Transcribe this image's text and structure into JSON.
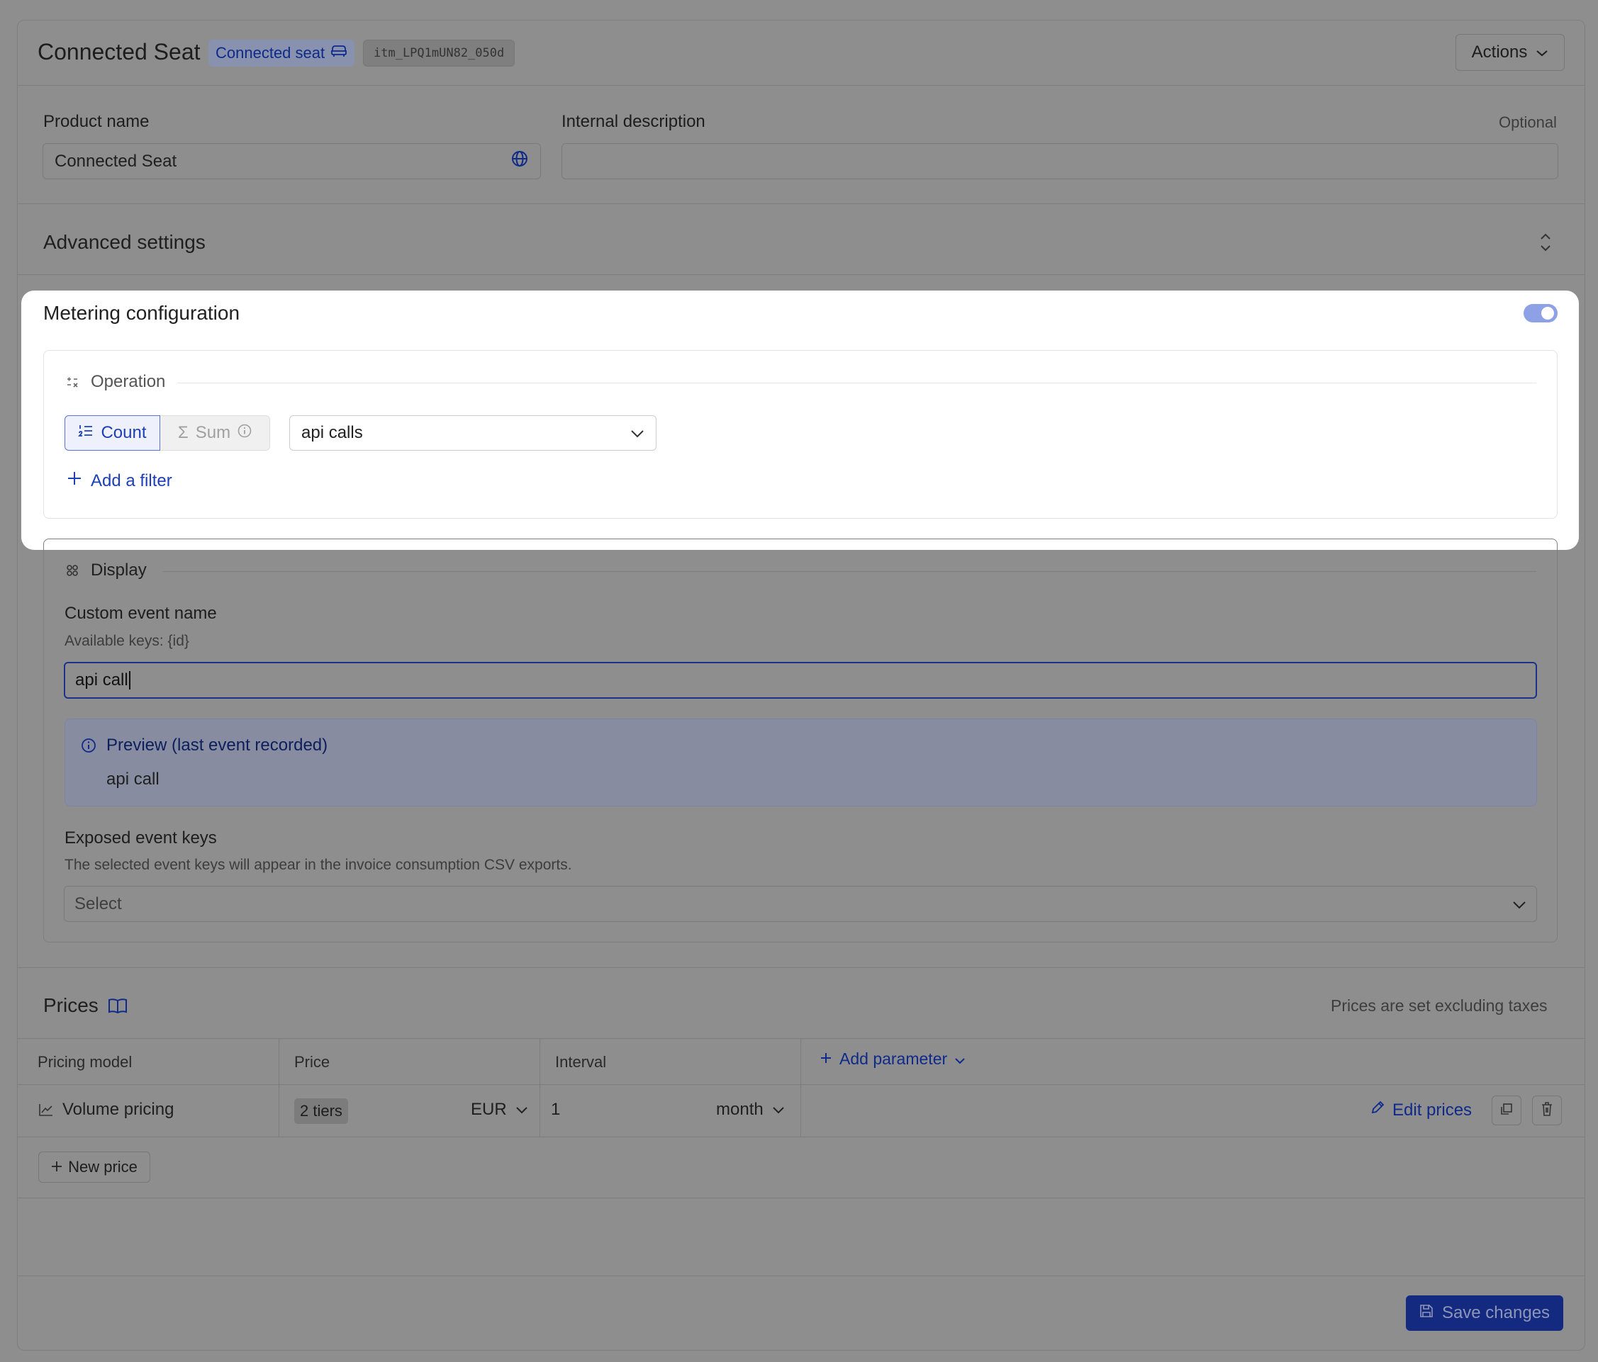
{
  "header": {
    "title": "Connected Seat",
    "type_badge": "Connected seat",
    "item_id": "itm_LPQ1mUN82_050d",
    "actions_label": "Actions"
  },
  "fields": {
    "product_name_label": "Product name",
    "product_name_value": "Connected Seat",
    "internal_description_label": "Internal description",
    "optional_label": "Optional",
    "internal_description_value": ""
  },
  "advanced": {
    "title": "Advanced settings"
  },
  "metering": {
    "title": "Metering configuration",
    "toggle_on": true,
    "operation_label": "Operation",
    "count_label": "Count",
    "sum_label": "Sum",
    "event_select_value": "api calls",
    "add_filter_label": "Add a filter"
  },
  "display": {
    "section_label": "Display",
    "custom_event_name_label": "Custom event name",
    "available_keys_hint": "Available keys: {id}",
    "custom_event_name_value": "api call",
    "preview_title": "Preview (last event recorded)",
    "preview_value": "api call",
    "exposed_keys_label": "Exposed event keys",
    "exposed_keys_help": "The selected event keys will appear in the invoice consumption CSV exports.",
    "exposed_keys_placeholder": "Select"
  },
  "prices": {
    "title": "Prices",
    "tax_note": "Prices are set excluding taxes",
    "columns": [
      "Pricing model",
      "Price",
      "Interval"
    ],
    "add_parameter_label": "Add parameter",
    "rows": [
      {
        "pricing_model": "Volume pricing",
        "tiers": "2 tiers",
        "currency": "EUR",
        "interval_count": "1",
        "interval_unit": "month",
        "edit_label": "Edit prices"
      }
    ],
    "new_price_label": "New price"
  },
  "footer": {
    "save_label": "Save changes"
  },
  "colors": {
    "accent": "#1d3fb8",
    "save_button": "#142a80",
    "toggle": "#8ea1e6"
  }
}
